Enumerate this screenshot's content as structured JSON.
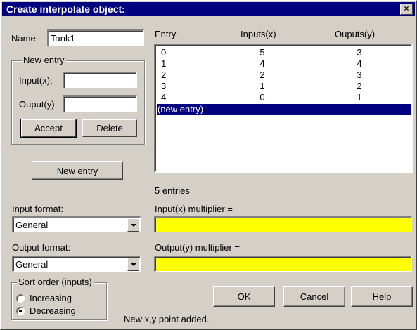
{
  "window": {
    "title": "Create interpolate object:",
    "close_label": "×"
  },
  "name_field": {
    "label": "Name:",
    "value": "Tank1"
  },
  "new_entry_group": {
    "legend": "New entry",
    "input_label": "Input(x):",
    "input_value": "",
    "output_label": "Ouput(y):",
    "output_value": "",
    "accept_label": "Accept",
    "delete_label": "Delete"
  },
  "new_entry_button": "New entry",
  "table": {
    "headers": [
      "Entry",
      "Inputs(x)",
      "Ouputs(y)"
    ],
    "rows": [
      {
        "entry": "0",
        "input": "5",
        "output": "3"
      },
      {
        "entry": "1",
        "input": "4",
        "output": "4"
      },
      {
        "entry": "2",
        "input": "2",
        "output": "3"
      },
      {
        "entry": "3",
        "input": "1",
        "output": "2"
      },
      {
        "entry": "4",
        "input": "0",
        "output": "1"
      }
    ],
    "new_entry_row": "(new entry)",
    "count_text": "5 entries"
  },
  "input_format": {
    "label": "Input format:",
    "value": "General"
  },
  "output_format": {
    "label": "Output format:",
    "value": "General"
  },
  "input_multiplier": {
    "label": "Input(x) multiplier =",
    "value": ""
  },
  "output_multiplier": {
    "label": "Output(y) multiplier =",
    "value": ""
  },
  "sort_order": {
    "legend": "Sort order (inputs)",
    "options": [
      "Increasing",
      "Decreasing"
    ],
    "selected": "Decreasing"
  },
  "buttons": {
    "ok": "OK",
    "cancel": "Cancel",
    "help": "Help"
  },
  "status_text": "New x,y point added.",
  "colors": {
    "title_bar": "#000080",
    "highlight": "#000080",
    "multiplier_field": "#ffff00",
    "dialog_bg": "#d4d0c8"
  }
}
